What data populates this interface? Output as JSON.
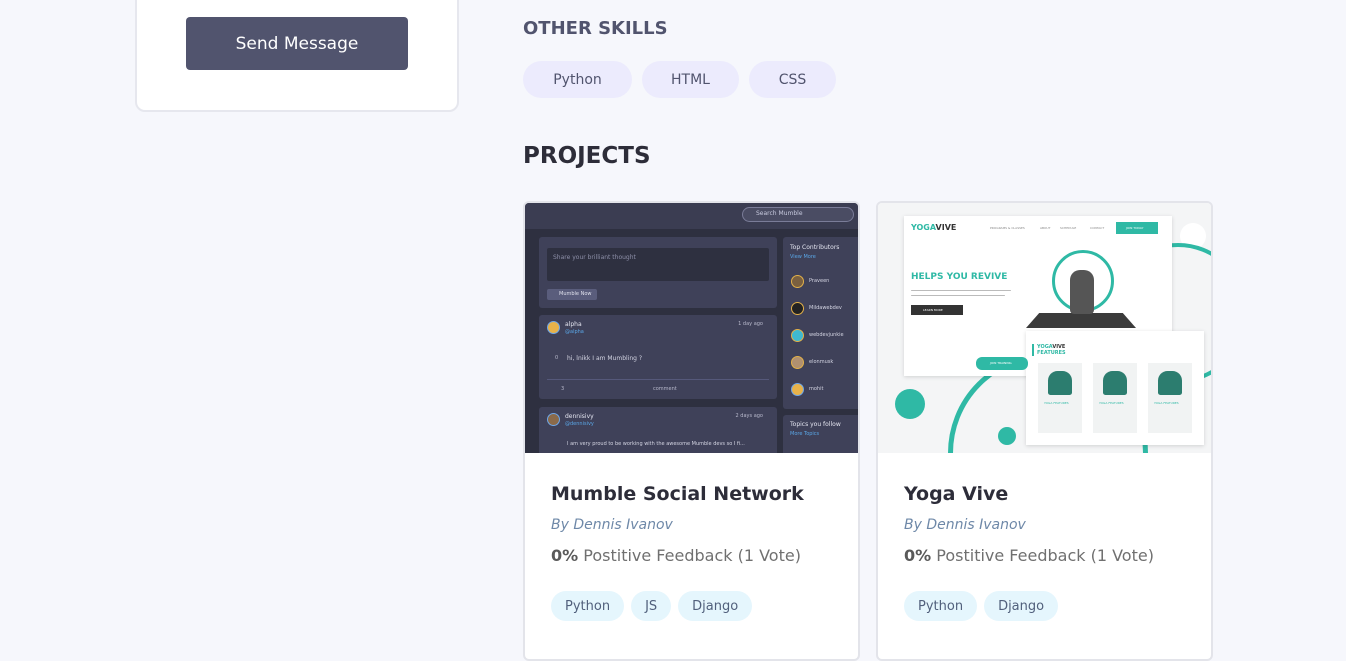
{
  "contact": {
    "send_label": "Send Message"
  },
  "other_skills": {
    "title": "OTHER SKILLS",
    "items": [
      "Python",
      "HTML",
      "CSS"
    ]
  },
  "projects": {
    "title": "PROJECTS",
    "items": [
      {
        "title": "Mumble Social Network",
        "author": "By Dennis Ivanov",
        "feedback_pct": "0%",
        "feedback_text": "Postitive Feedback (1 Vote)",
        "tags": [
          "Python",
          "JS",
          "Django"
        ],
        "thumb": {
          "search": "Search Mumble",
          "post_placeholder": "Share your brilliant thought",
          "post_button": "Mumble Now",
          "top_contributors": "Top Contributors",
          "view_more": "View More",
          "contributors": [
            "Praveen",
            "Mildawebdev",
            "webdevjunkie",
            "elonmusk",
            "mohit"
          ],
          "post1_user": "alpha",
          "post1_handle": "@alpha",
          "post1_time": "1 day ago",
          "post1_text": "hi, lnikk I am Mumbling ?",
          "post1_votes": "0",
          "post1_comments": "3",
          "comment": "comment",
          "post2_user": "dennisivy",
          "post2_handle": "@dennisivy",
          "post2_time": "2 days ago",
          "post2_text": "I am very proud to be working with the awesome Mumble devs so I fi...",
          "topics": "Topics you follow",
          "more_topics": "More Topics"
        }
      },
      {
        "title": "Yoga Vive",
        "author": "By Dennis Ivanov",
        "feedback_pct": "0%",
        "feedback_text": "Postitive Feedback (1 Vote)",
        "tags": [
          "Python",
          "Django"
        ],
        "thumb": {
          "logo_a": "YOGA",
          "logo_b": "VIVE",
          "nav": [
            "PROGRAMS & CLASSES",
            "ABOUT",
            "SCHEDULE",
            "CONTACT"
          ],
          "join": "JOIN TODAY",
          "headline": "HELPS YOU REVIVE",
          "learn": "LEARN MORE",
          "features_a": "YOGA",
          "features_b": "VIVE",
          "features_c": "FEATURES",
          "feature_item": "YOGA FEATURES",
          "feature_btn": "LEARN MORE",
          "trainer": "JOIN TRAINING"
        }
      }
    ]
  }
}
